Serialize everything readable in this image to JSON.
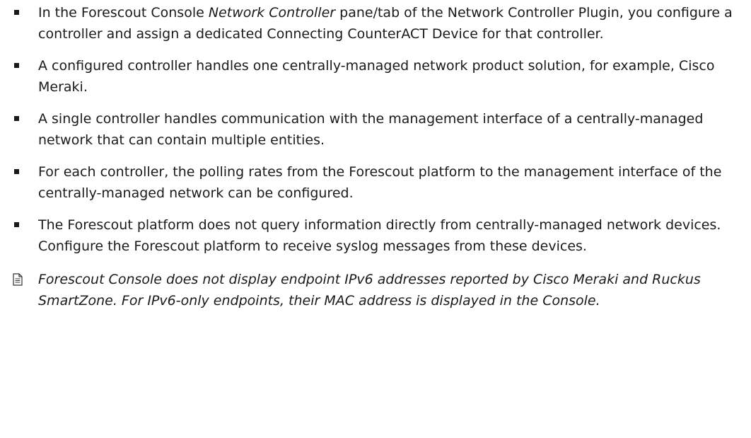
{
  "bullets": [
    {
      "pre": "In the Forescout Console ",
      "em": "Network Controller",
      "post": " pane/tab of the Network Controller Plugin, you configure a controller and assign a dedicated Connecting CounterACT Device for that controller."
    },
    {
      "pre": "A configured controller handles one centrally-managed network product solution, for example, Cisco Meraki.",
      "em": "",
      "post": ""
    },
    {
      "pre": "A single controller handles communication with the management interface of a centrally-managed network that can contain multiple entities.",
      "em": "",
      "post": ""
    },
    {
      "pre": "For each controller, the polling rates from the Forescout platform to the management interface of the centrally-managed network can be configured.",
      "em": "",
      "post": ""
    },
    {
      "pre": "The Forescout platform does not query information directly from centrally-managed network devices. Configure the Forescout platform to receive syslog messages from these devices.",
      "em": "",
      "post": ""
    }
  ],
  "note": {
    "icon": "note-icon",
    "text": "Forescout Console does not display endpoint IPv6 addresses reported by Cisco Meraki and Ruckus SmartZone. For IPv6-only endpoints, their MAC address is displayed in the Console."
  }
}
